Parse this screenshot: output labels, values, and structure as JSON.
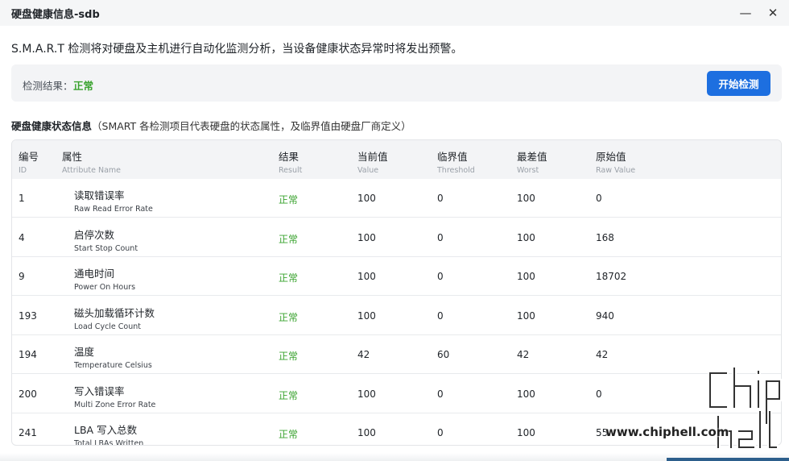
{
  "window": {
    "title": "硬盘健康信息-sdb",
    "minimize_icon": "minimize-icon",
    "close_icon": "close-icon"
  },
  "description": "S.M.A.R.T 检测将对硬盘及主机进行自动化监测分析，当设备健康状态异常时将发出预警。",
  "result": {
    "label": "检测结果：",
    "value": "正常",
    "value_color": "#3aa32f",
    "button_label": "开始检测",
    "button_color": "#1d6fe0"
  },
  "section": {
    "title": "硬盘健康状态信息",
    "note": "（SMART 各检测项目代表硬盘的状态属性，及临界值由硬盘厂商定义）"
  },
  "table": {
    "headers": [
      {
        "cn": "编号",
        "en": "ID"
      },
      {
        "cn": "属性",
        "en": "Attribute Name"
      },
      {
        "cn": "结果",
        "en": "Result"
      },
      {
        "cn": "当前值",
        "en": "Value"
      },
      {
        "cn": "临界值",
        "en": "Threshold"
      },
      {
        "cn": "最差值",
        "en": "Worst"
      },
      {
        "cn": "原始值",
        "en": "Raw Value"
      }
    ],
    "rows": [
      {
        "id": "1",
        "attr_cn": "读取错误率",
        "attr_en": "Raw Read Error Rate",
        "result": "正常",
        "value": "100",
        "threshold": "0",
        "worst": "100",
        "raw": "0"
      },
      {
        "id": "4",
        "attr_cn": "启停次数",
        "attr_en": "Start Stop Count",
        "result": "正常",
        "value": "100",
        "threshold": "0",
        "worst": "100",
        "raw": "168"
      },
      {
        "id": "9",
        "attr_cn": "通电时间",
        "attr_en": "Power On Hours",
        "result": "正常",
        "value": "100",
        "threshold": "0",
        "worst": "100",
        "raw": "18702"
      },
      {
        "id": "193",
        "attr_cn": "磁头加载循环计数",
        "attr_en": "Load Cycle Count",
        "result": "正常",
        "value": "100",
        "threshold": "0",
        "worst": "100",
        "raw": "940"
      },
      {
        "id": "194",
        "attr_cn": "温度",
        "attr_en": "Temperature Celsius",
        "result": "正常",
        "value": "42",
        "threshold": "60",
        "worst": "42",
        "raw": "42"
      },
      {
        "id": "200",
        "attr_cn": "写入错误率",
        "attr_en": "Multi Zone Error Rate",
        "result": "正常",
        "value": "100",
        "threshold": "0",
        "worst": "100",
        "raw": "0"
      },
      {
        "id": "241",
        "attr_cn": "LBA 写入总数",
        "attr_en": "Total LBAs Written",
        "result": "正常",
        "value": "100",
        "threshold": "0",
        "worst": "100",
        "raw": "55"
      }
    ]
  },
  "watermark": {
    "text": "www.chiphell.com"
  }
}
